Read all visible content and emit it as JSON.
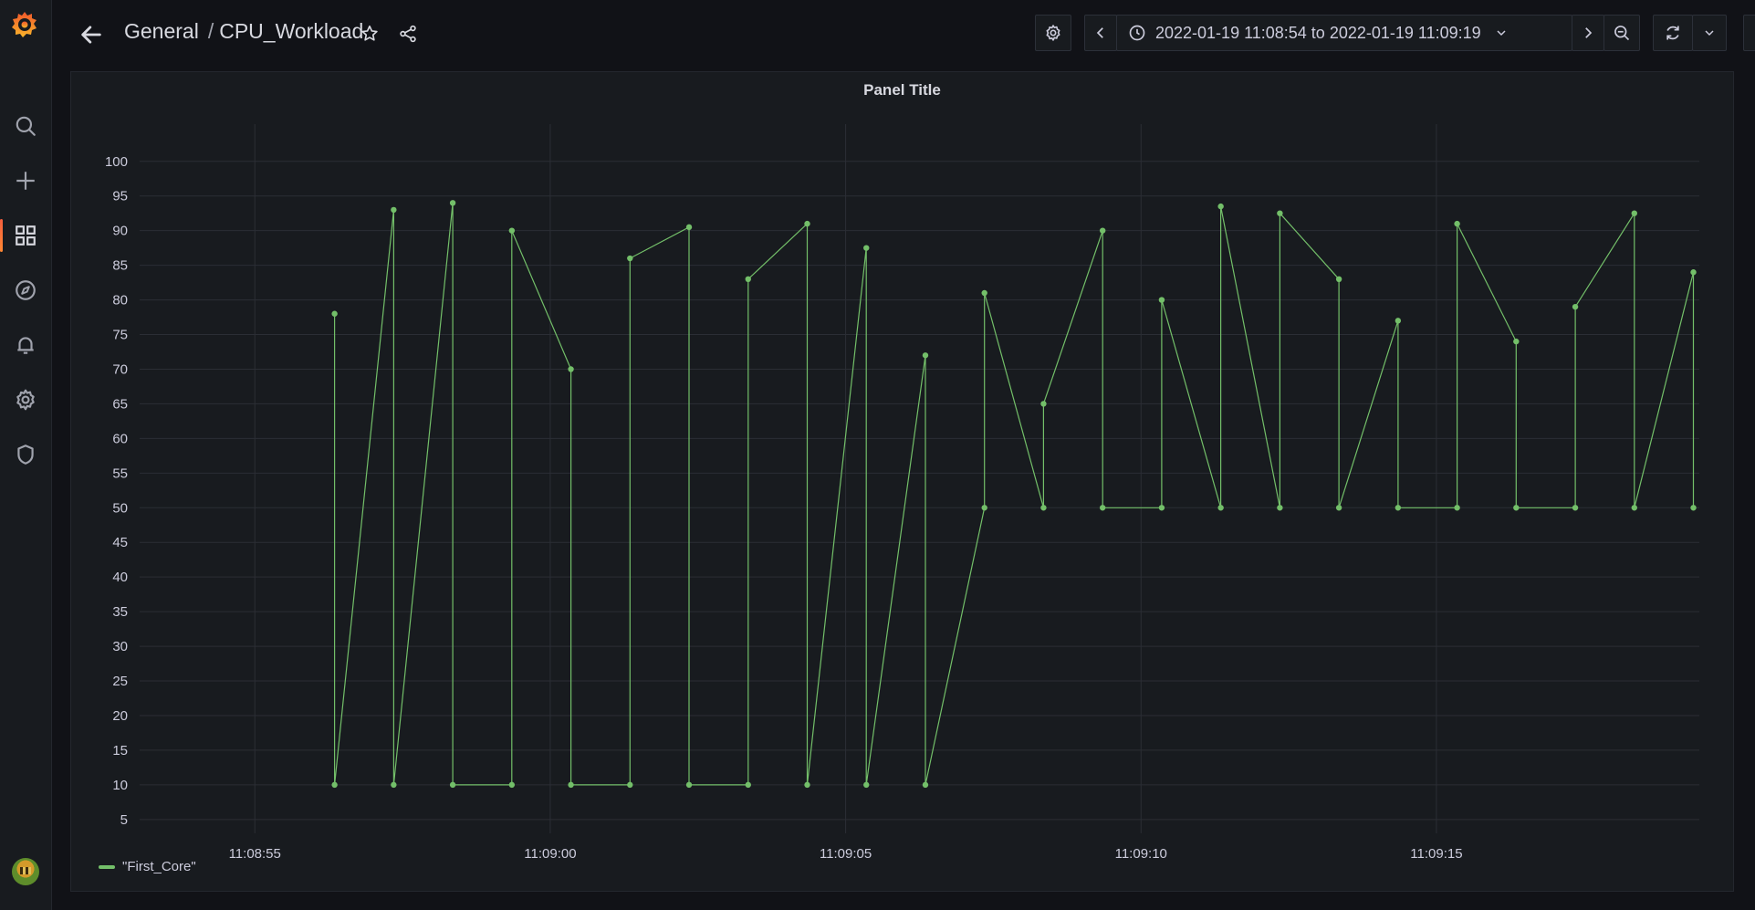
{
  "header": {
    "breadcrumb": {
      "folder": "General",
      "separator": "/",
      "dashboard": "CPU_Workload"
    },
    "time_range": "2022-01-19 11:08:54 to 2022-01-19 11:09:19"
  },
  "icons": {
    "sidebar": [
      "grafana-logo-icon",
      "search-icon",
      "plus-icon",
      "dashboards-icon",
      "explore-icon",
      "alerting-icon",
      "configuration-icon",
      "server-admin-shield-icon"
    ],
    "topbar": [
      "arrow-left-icon",
      "star-icon",
      "share-icon",
      "cog-icon",
      "chevron-left-icon",
      "clock-icon",
      "chevron-down-icon",
      "chevron-right-icon",
      "zoom-out-icon",
      "sync-icon",
      "chevron-down-icon",
      "monitor-icon"
    ]
  },
  "colors": {
    "series": "#73bf69",
    "accent": "#f55f3e",
    "background": "#111217",
    "panel": "#181b1f"
  },
  "panel": {
    "title": "Panel Title"
  },
  "chart_data": {
    "type": "line",
    "title": "Panel Title",
    "x_ticks": [
      "11:08:55",
      "11:09:00",
      "11:09:05",
      "11:09:10",
      "11:09:15"
    ],
    "y_ticks": [
      5,
      10,
      15,
      20,
      25,
      30,
      35,
      40,
      45,
      50,
      55,
      60,
      65,
      70,
      75,
      80,
      85,
      90,
      95,
      100
    ],
    "xlim": [
      "11:08:53.05",
      "11:09:19.45"
    ],
    "ylim": [
      3,
      103
    ],
    "grid": true,
    "legend": "bottom-left",
    "series": [
      {
        "name": "\"First_Core\"",
        "color": "#73bf69",
        "points": [
          [
            "11:08:56.35",
            78
          ],
          [
            "11:08:56.35",
            10
          ],
          [
            "11:08:57.35",
            93
          ],
          [
            "11:08:57.35",
            10
          ],
          [
            "11:08:58.35",
            94
          ],
          [
            "11:08:58.35",
            10
          ],
          [
            "11:08:59.35",
            10
          ],
          [
            "11:08:59.35",
            90
          ],
          [
            "11:09:00.35",
            70
          ],
          [
            "11:09:00.35",
            10
          ],
          [
            "11:09:01.35",
            10
          ],
          [
            "11:09:01.35",
            86
          ],
          [
            "11:09:02.35",
            90.5
          ],
          [
            "11:09:02.35",
            10
          ],
          [
            "11:09:03.35",
            10
          ],
          [
            "11:09:03.35",
            83
          ],
          [
            "11:09:04.35",
            91
          ],
          [
            "11:09:04.35",
            10
          ],
          [
            "11:09:05.35",
            87.5
          ],
          [
            "11:09:05.35",
            10
          ],
          [
            "11:09:06.35",
            72
          ],
          [
            "11:09:06.35",
            10
          ],
          [
            "11:09:07.35",
            50
          ],
          [
            "11:09:07.35",
            81
          ],
          [
            "11:09:08.35",
            50
          ],
          [
            "11:09:08.35",
            65
          ],
          [
            "11:09:09.35",
            90
          ],
          [
            "11:09:09.35",
            50
          ],
          [
            "11:09:10.35",
            50
          ],
          [
            "11:09:10.35",
            80
          ],
          [
            "11:09:11.35",
            50
          ],
          [
            "11:09:11.35",
            93.5
          ],
          [
            "11:09:12.35",
            50
          ],
          [
            "11:09:12.35",
            92.5
          ],
          [
            "11:09:13.35",
            83
          ],
          [
            "11:09:13.35",
            50
          ],
          [
            "11:09:14.35",
            77
          ],
          [
            "11:09:14.35",
            50
          ],
          [
            "11:09:15.35",
            50
          ],
          [
            "11:09:15.35",
            91
          ],
          [
            "11:09:16.35",
            74
          ],
          [
            "11:09:16.35",
            50
          ],
          [
            "11:09:17.35",
            50
          ],
          [
            "11:09:17.35",
            79
          ],
          [
            "11:09:18.35",
            92.5
          ],
          [
            "11:09:18.35",
            50
          ],
          [
            "11:09:19.35",
            84
          ],
          [
            "11:09:19.35",
            50
          ]
        ]
      }
    ]
  }
}
